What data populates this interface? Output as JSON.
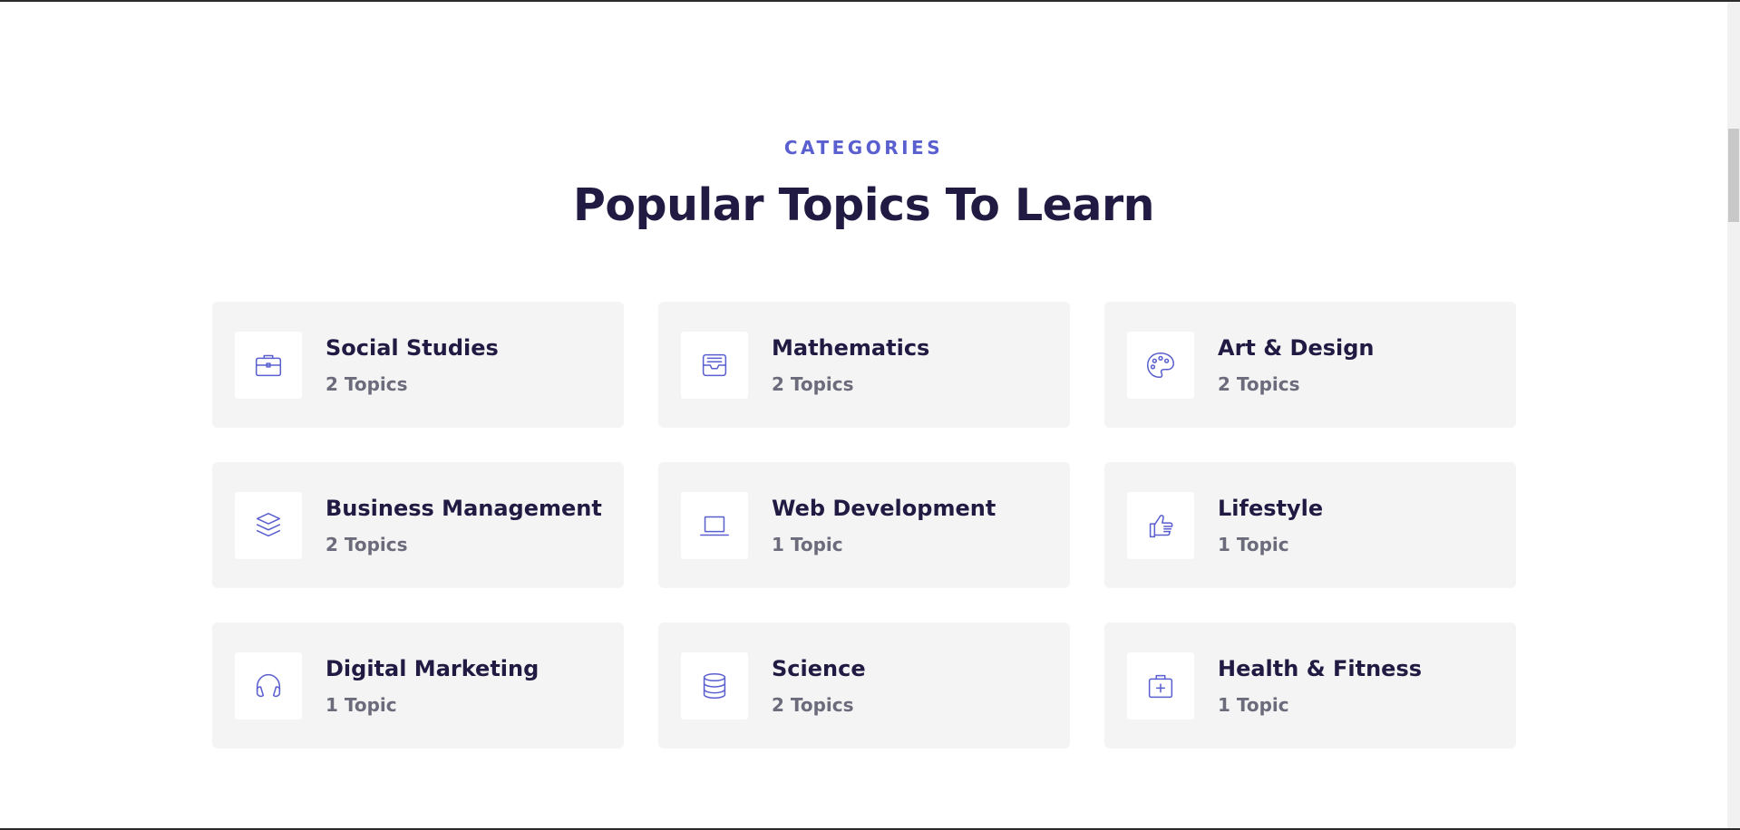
{
  "header": {
    "eyebrow": "CATEGORIES",
    "title": "Popular Topics To Learn"
  },
  "categories": [
    {
      "name": "Social Studies",
      "count": "2 Topics",
      "icon": "briefcase-icon"
    },
    {
      "name": "Mathematics",
      "count": "2 Topics",
      "icon": "inbox-tray-icon"
    },
    {
      "name": "Art & Design",
      "count": "2 Topics",
      "icon": "palette-icon"
    },
    {
      "name": "Business Management",
      "count": "2 Topics",
      "icon": "layers-icon"
    },
    {
      "name": "Web Development",
      "count": "1 Topic",
      "icon": "laptop-icon"
    },
    {
      "name": "Lifestyle",
      "count": "1 Topic",
      "icon": "thumbs-up-icon"
    },
    {
      "name": "Digital Marketing",
      "count": "1 Topic",
      "icon": "headphones-icon"
    },
    {
      "name": "Science",
      "count": "2 Topics",
      "icon": "database-icon"
    },
    {
      "name": "Health & Fitness",
      "count": "1 Topic",
      "icon": "medical-kit-icon"
    }
  ],
  "colors": {
    "accent": "#5a5fcf",
    "heading": "#211b43",
    "muted": "#6b6b7b",
    "card_bg": "#f4f4f4"
  }
}
